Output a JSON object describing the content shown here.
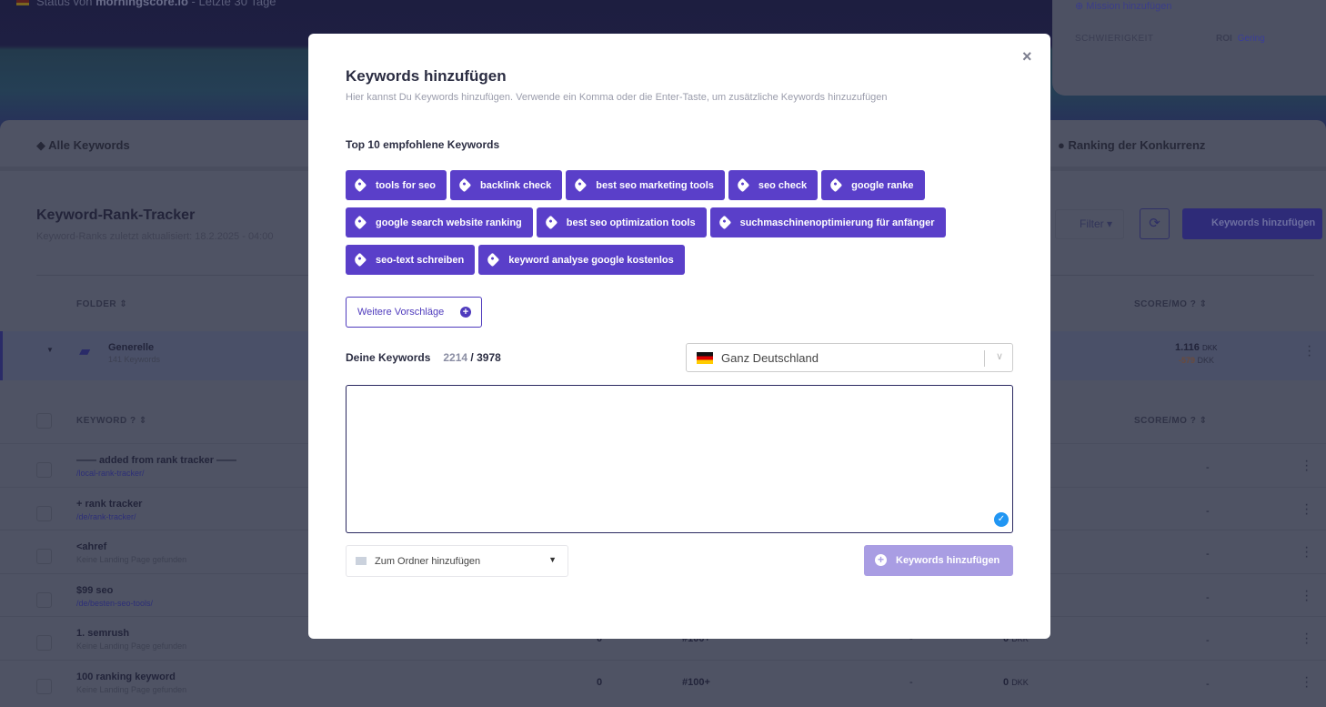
{
  "background": {
    "status": {
      "prefix": "Status von",
      "site": "morningscore.io",
      "suffix": "- Letzte 30 Tage"
    },
    "mission": {
      "add": "Mission hinzufügen",
      "difficulty": "SCHWIERIGKEIT",
      "roi_label": "ROI",
      "roi_value": "Gering"
    },
    "tabs": [
      "Alle Keywords",
      "Ranking der Konkurrenz"
    ],
    "title": "Keyword-Rank-Tracker",
    "updated": "Keyword-Ranks zuletzt aktualisiert: 18.2.2025 - 04:00",
    "filter": "Filter",
    "add_button": "Keywords hinzufügen",
    "folder_header": "FOLDER",
    "score_header": "SCORE/MO",
    "keyword_header": "KEYWORD",
    "folder": {
      "name": "Generelle",
      "count": "141 Keywords",
      "score": "1.116",
      "score_delta": "-579",
      "currency": "DKK"
    },
    "rows": [
      {
        "keyword": "—— added from rank tracker ——",
        "page": "/local-rank-tracker/",
        "score": "-"
      },
      {
        "keyword": "+ rank tracker",
        "page": "/de/rank-tracker/",
        "score": "-"
      },
      {
        "keyword": "<ahref",
        "page": "Keine Landing Page gefunden",
        "score": "-"
      },
      {
        "keyword": "$99 seo",
        "page": "/de/besten-seo-tools/",
        "score": "-"
      },
      {
        "keyword": "1. semrush",
        "page": "Keine Landing Page gefunden",
        "volume": "0",
        "rank": "#100+",
        "mid": "-",
        "value": "0",
        "currency": "DKK",
        "score": "-"
      },
      {
        "keyword": "100 ranking keyword",
        "page": "Keine Landing Page gefunden",
        "volume": "0",
        "rank": "#100+",
        "mid": "-",
        "value": "0",
        "currency": "DKK",
        "score": "-"
      }
    ]
  },
  "modal": {
    "title": "Keywords hinzufügen",
    "subtitle": "Hier kannst Du Keywords hinzufügen. Verwende ein Komma oder die Enter-Taste, um zusätzliche Keywords hinzuzufügen",
    "suggest_title": "Top 10 empfohlene Keywords",
    "suggestions": [
      "tools for seo",
      "backlink check",
      "best seo marketing tools",
      "seo check",
      "google ranke",
      "google search website ranking",
      "best seo optimization tools",
      "suchmaschinenoptimierung für anfänger",
      "seo-text schreiben",
      "keyword analyse google kostenlos"
    ],
    "more": "Weitere Vorschläge",
    "your_keywords": "Deine Keywords",
    "used": "2214",
    "limit": "3978",
    "country": "Ganz Deutschland",
    "textarea_value": "",
    "folder_select": "Zum Ordner hinzufügen",
    "submit": "Keywords hinzufügen",
    "close": "×"
  },
  "colors": {
    "accent": "#5a3fc9",
    "submit_disabled": "#a99de3"
  }
}
